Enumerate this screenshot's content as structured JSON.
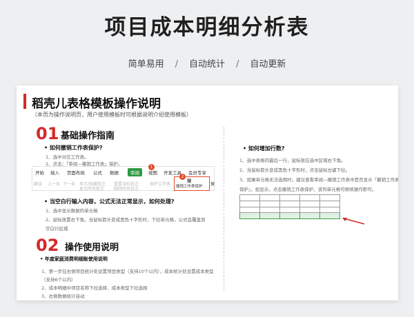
{
  "page_title": "项目成本明细分析表",
  "subnav": [
    "简单易用",
    "/",
    "自动统计",
    "/",
    "自动更新"
  ],
  "card": {
    "heading": "稻壳儿表格模板操作说明",
    "note": "（本页为操作说明页，用户使用模板时可根据说明介绍使用模板）",
    "section1": {
      "num": "01",
      "title": "基础操作指南",
      "q1": "如何撤销工作表保护?",
      "q1_steps": [
        "1、选中对应工作表。",
        "2、点击：「审阅—撤销工作表」保护。"
      ],
      "ribbon_tabs": [
        "开始",
        "插入",
        "页面布局",
        "公式",
        "数据",
        "审阅",
        "视图",
        "开发工具",
        "会员专享"
      ],
      "ribbon_active": "审阅",
      "ribbon_tools": [
        "翻译",
        "上一条",
        "下一条",
        "显示/隐藏批注",
        "显示所有批注",
        "重置当前批注",
        "删除所有批注",
        "保护工作表"
      ],
      "ribbon_highlight": "撤销工作表保护",
      "ribbon_mark": "保",
      "badge1": "1",
      "badge2": "2",
      "q2": "当空白行输入内容，公式无法正常显示，如何处理?",
      "q2_steps": [
        "1、选中显示数据的单元格",
        "2、鼠标放置右下角，当鼠标箭头变成黑色十字形时，下拉单元格，公式会覆盖到",
        "空白行区域"
      ],
      "q3": "如何增加行数?",
      "q3_steps": [
        "1、选中表格的最后一行，鼠标放在选中区域右下角。",
        "2、当鼠标箭头变成黑色十字形时，点击鼠标左键下拉。",
        "3、如果单元格无法选用时，建议查看审阅—撤销工作表中是否显示「撤销工作表",
        "保护」，如显示，点击撤销工作表保护，该列单元格可继续操作即可。"
      ]
    },
    "section2": {
      "num": "02",
      "title": "操作使用说明",
      "sub": "年度家庭消费明细账使用说明",
      "steps": [
        "1、第一步在右侧项目统计处设置项目类型（支持10个以内），成本统计处设置成本类型",
        "（支持6个以内）",
        "2、成本明细中项目名称下拉选择、成本类型下拉选择",
        "3、右侧数据统计自动"
      ]
    }
  },
  "colors": {
    "accent": "#d32a2a",
    "ribbon_active": "#2f9a45",
    "highlight": "#e04a2a"
  }
}
